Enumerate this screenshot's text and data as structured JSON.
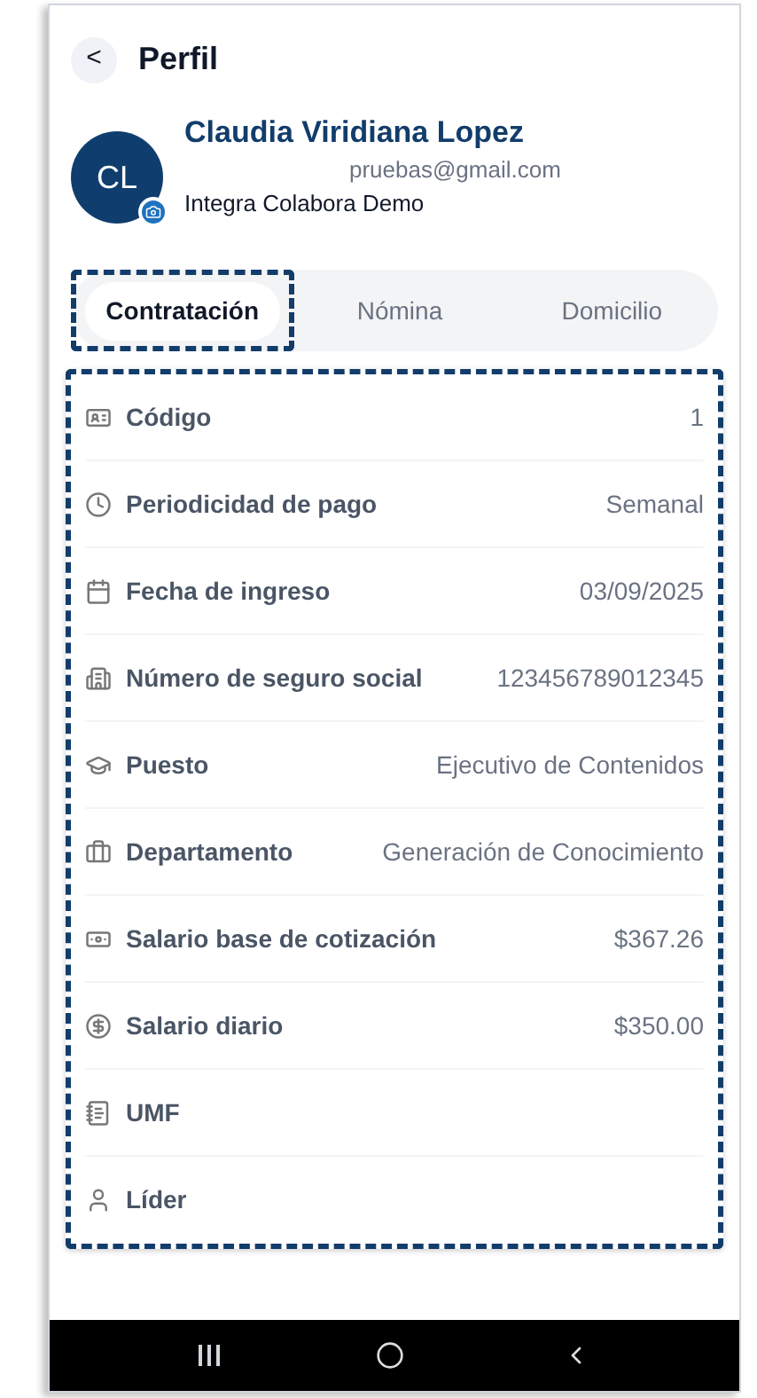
{
  "header": {
    "back": "<",
    "title": "Perfil"
  },
  "profile": {
    "initials": "CL",
    "name": "Claudia Viridiana Lopez",
    "email": "pruebas@gmail.com",
    "company": "Integra Colabora Demo"
  },
  "tabs": [
    {
      "label": "Contratación",
      "selected": true
    },
    {
      "label": "Nómina",
      "selected": false
    },
    {
      "label": "Domicilio",
      "selected": false
    }
  ],
  "fields": [
    {
      "label": "Código",
      "value": "1"
    },
    {
      "label": "Periodicidad de pago",
      "value": "Semanal"
    },
    {
      "label": "Fecha de ingreso",
      "value": "03/09/2025"
    },
    {
      "label": "Número de seguro social",
      "value": "123456789012345"
    },
    {
      "label": "Puesto",
      "value": "Ejecutivo de Contenidos"
    },
    {
      "label": "Departamento",
      "value": "Generación de Conocimiento"
    },
    {
      "label": "Salario base de cotización",
      "value": "$367.26"
    },
    {
      "label": "Salario diario",
      "value": "$350.00"
    },
    {
      "label": "UMF"
    },
    {
      "label": "Líder"
    }
  ]
}
